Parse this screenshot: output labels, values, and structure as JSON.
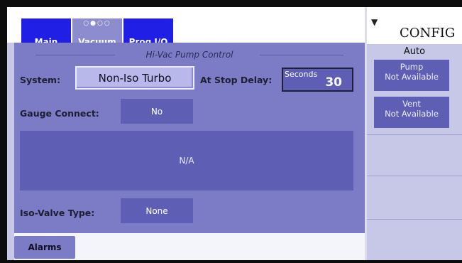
{
  "tabs": [
    {
      "label": "Main",
      "active": false
    },
    {
      "label": "Vacuum",
      "active": true,
      "indicator": "○●○○"
    },
    {
      "label": "Prog I/O",
      "active": false
    }
  ],
  "section": {
    "title": "Hi-Vac Pump Control"
  },
  "system": {
    "label": "System:",
    "value": "Non-Iso Turbo"
  },
  "stop_delay": {
    "label": "At Stop Delay:",
    "unit": "Seconds",
    "value": "30"
  },
  "gauge": {
    "label": "Gauge Connect:",
    "value": "No"
  },
  "info_box": {
    "text": "N/A"
  },
  "iso_valve": {
    "label": "Iso-Valve Type:",
    "value": "None"
  },
  "bottom": {
    "alarms_label": "Alarms"
  },
  "config": {
    "title": "CONFIG",
    "mode": "Auto",
    "pump": {
      "name": "Pump",
      "status": "Not Available"
    },
    "vent": {
      "name": "Vent",
      "status": "Not Available"
    }
  },
  "colors": {
    "accent": "#1f1fe6",
    "panel": "#7c7cc6",
    "field": "#5e5eb4"
  }
}
